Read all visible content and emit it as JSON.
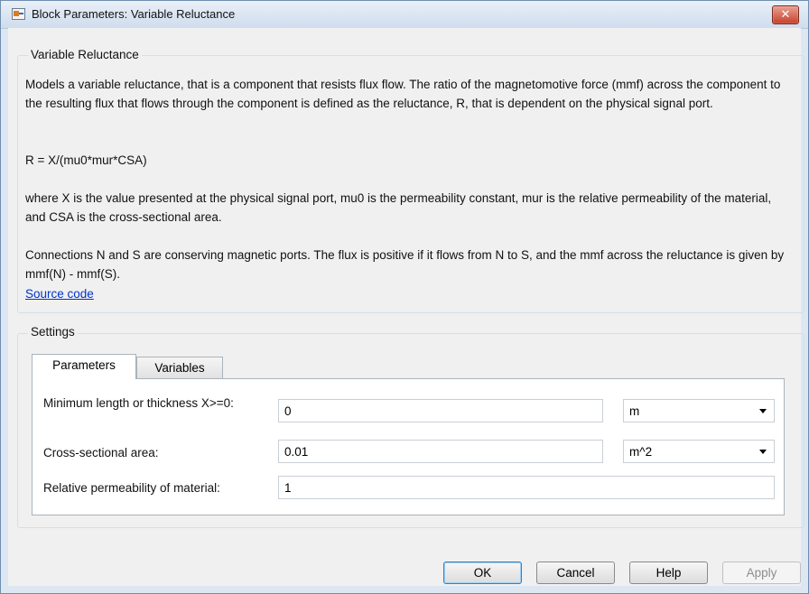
{
  "window": {
    "title": "Block Parameters: Variable Reluctance",
    "close_glyph": "✕"
  },
  "description": {
    "group_title": "Variable Reluctance",
    "paragraph1": "Models a variable reluctance, that is a component that resists flux flow. The ratio of the magnetomotive force (mmf) across the component to the resulting flux that flows through the component is defined as the reluctance, R, that is dependent on the physical signal port.",
    "formula": "R = X/(mu0*mur*CSA)",
    "paragraph2": "where X is the value presented at the physical signal port, mu0 is the permeability constant, mur is the relative permeability of the material, and CSA is the cross-sectional area.",
    "paragraph3": "Connections N and S are conserving magnetic ports. The flux is positive if it flows from N to S, and the mmf across the reluctance is given by mmf(N) - mmf(S).",
    "link": "Source code"
  },
  "settings": {
    "group_title": "Settings",
    "tabs": [
      {
        "label": "Parameters",
        "active": true
      },
      {
        "label": "Variables",
        "active": false
      }
    ],
    "params": [
      {
        "label": "Minimum length or thickness X>=0:",
        "value": "0",
        "unit": "m"
      },
      {
        "label": "Cross-sectional area:",
        "value": "0.01",
        "unit": "m^2"
      },
      {
        "label": "Relative permeability of material:",
        "value": "1"
      }
    ]
  },
  "buttons": {
    "ok": "OK",
    "cancel": "Cancel",
    "help": "Help",
    "apply": "Apply"
  },
  "colors": {
    "title_bar": "#dce7f3",
    "link": "#0033cc",
    "close_button": "#c6412c",
    "default_button_border": "#3c7fb1"
  },
  "icons": {
    "app": "simulink-block-icon",
    "close": "close-icon",
    "dropdown": "chevron-down-icon"
  }
}
